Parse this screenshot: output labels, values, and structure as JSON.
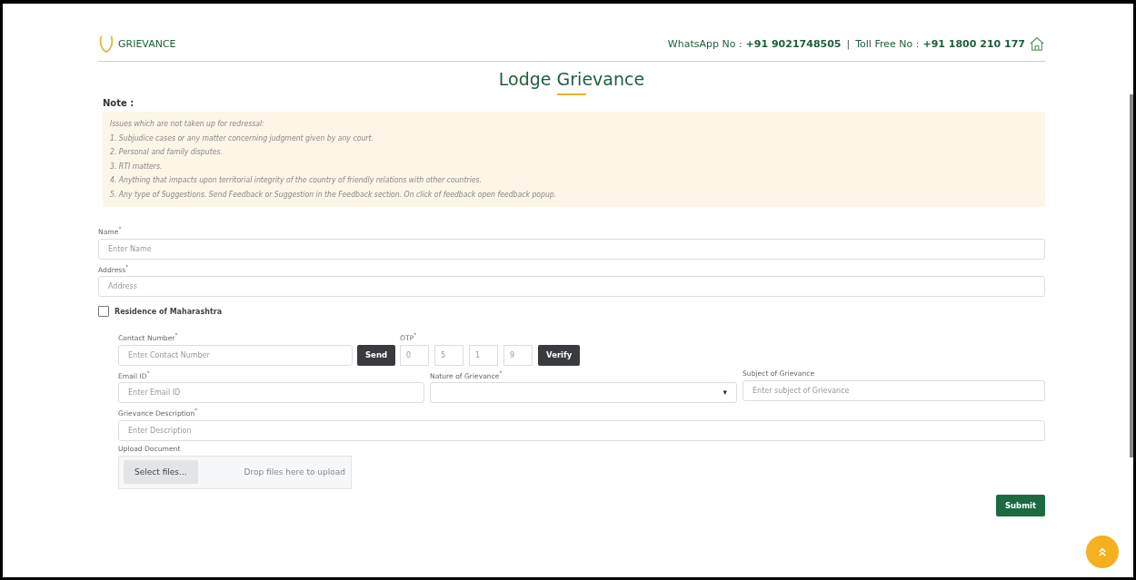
{
  "header": {
    "brand": "GRIEVANCE",
    "whatsapp_label": "WhatsApp No :",
    "whatsapp_number": "+91 9021748505",
    "separator": "|",
    "tollfree_label": "Toll Free No :",
    "tollfree_number": "+91 1800 210 177"
  },
  "title": "Lodge Grievance",
  "note": {
    "label": "Note :",
    "lines": [
      "Issues which are not taken up for redressal:",
      "1. Subjudice cases or any matter concerning judgment given by any court.",
      "2. Personal and family disputes.",
      "3. RTI matters.",
      "4. Anything that impacts upon territorial integrity of the country of friendly relations with other countries.",
      "5. Any type of Suggestions. Send Feedback or Suggestion in the Feedback section. On click of feedback open feedback popup."
    ]
  },
  "name": {
    "label": "Name$^{*}$",
    "placeholder": "Enter Name"
  },
  "address": {
    "label": "Address$^{*}$",
    "placeholder": "Address"
  },
  "residence": {
    "label": "Residence of Maharashtra",
    "checked": false
  },
  "contact": {
    "label": "Contact Number$^{*}$",
    "placeholder": "Enter Contact Number",
    "button": "Send"
  },
  "otp": {
    "label": "OTP$^{*}$",
    "digits": [
      "0",
      "5",
      "1",
      "9"
    ],
    "button": "Verify"
  },
  "email": {
    "label": "Email ID$^{*}$",
    "placeholder": "Enter Email ID"
  },
  "nature": {
    "label": "Nature of Grievance$^{*}$",
    "caret": "▾"
  },
  "subject": {
    "label": "Subject of Grievance",
    "placeholder": "Enter subject of Grievance"
  },
  "description": {
    "label": "Grievance Description$^{*}$",
    "placeholder": "Enter Description"
  },
  "upload": {
    "label": "Upload Document",
    "button": "Select files...",
    "hint": "Drop files here to upload"
  },
  "submit": "Submit"
}
